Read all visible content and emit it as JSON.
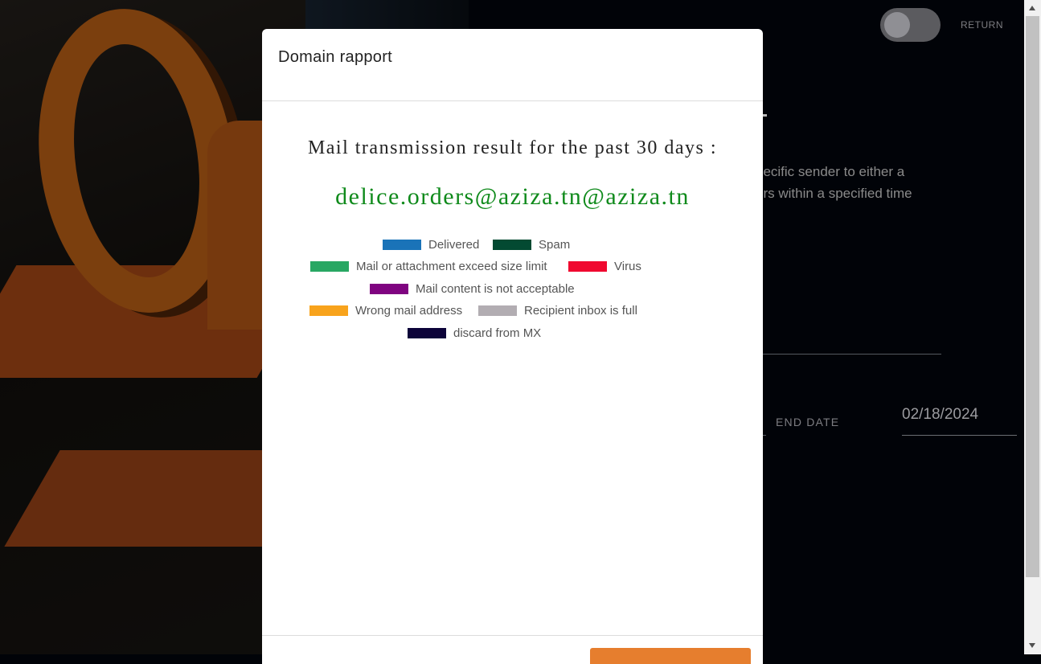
{
  "background": {
    "return_label": "RETURN",
    "description_line1": "pecific sender to either a",
    "description_line2": "ers within a specified time",
    "end_date_label": "END DATE",
    "end_date_value": "02/18/2024"
  },
  "modal": {
    "title": "Domain rapport",
    "heading": "Mail transmission result for the past 30 days :",
    "email": "delice.orders@aziza.tn@aziza.tn",
    "legend": [
      {
        "label": "Delivered",
        "color": "#1a73b8"
      },
      {
        "label": "Spam",
        "color": "#034a32"
      },
      {
        "label": "Mail or attachment exceed size limit",
        "color": "#28a763"
      },
      {
        "label": "Virus",
        "color": "#f0082f"
      },
      {
        "label": "Mail content is not acceptable",
        "color": "#7f0480"
      },
      {
        "label": "Wrong mail address",
        "color": "#f8a31c"
      },
      {
        "label": "Recipient inbox is full",
        "color": "#b2adb2"
      },
      {
        "label": "discard from MX",
        "color": "#0c0339"
      }
    ],
    "footer_button_color": "#e67e2e"
  }
}
